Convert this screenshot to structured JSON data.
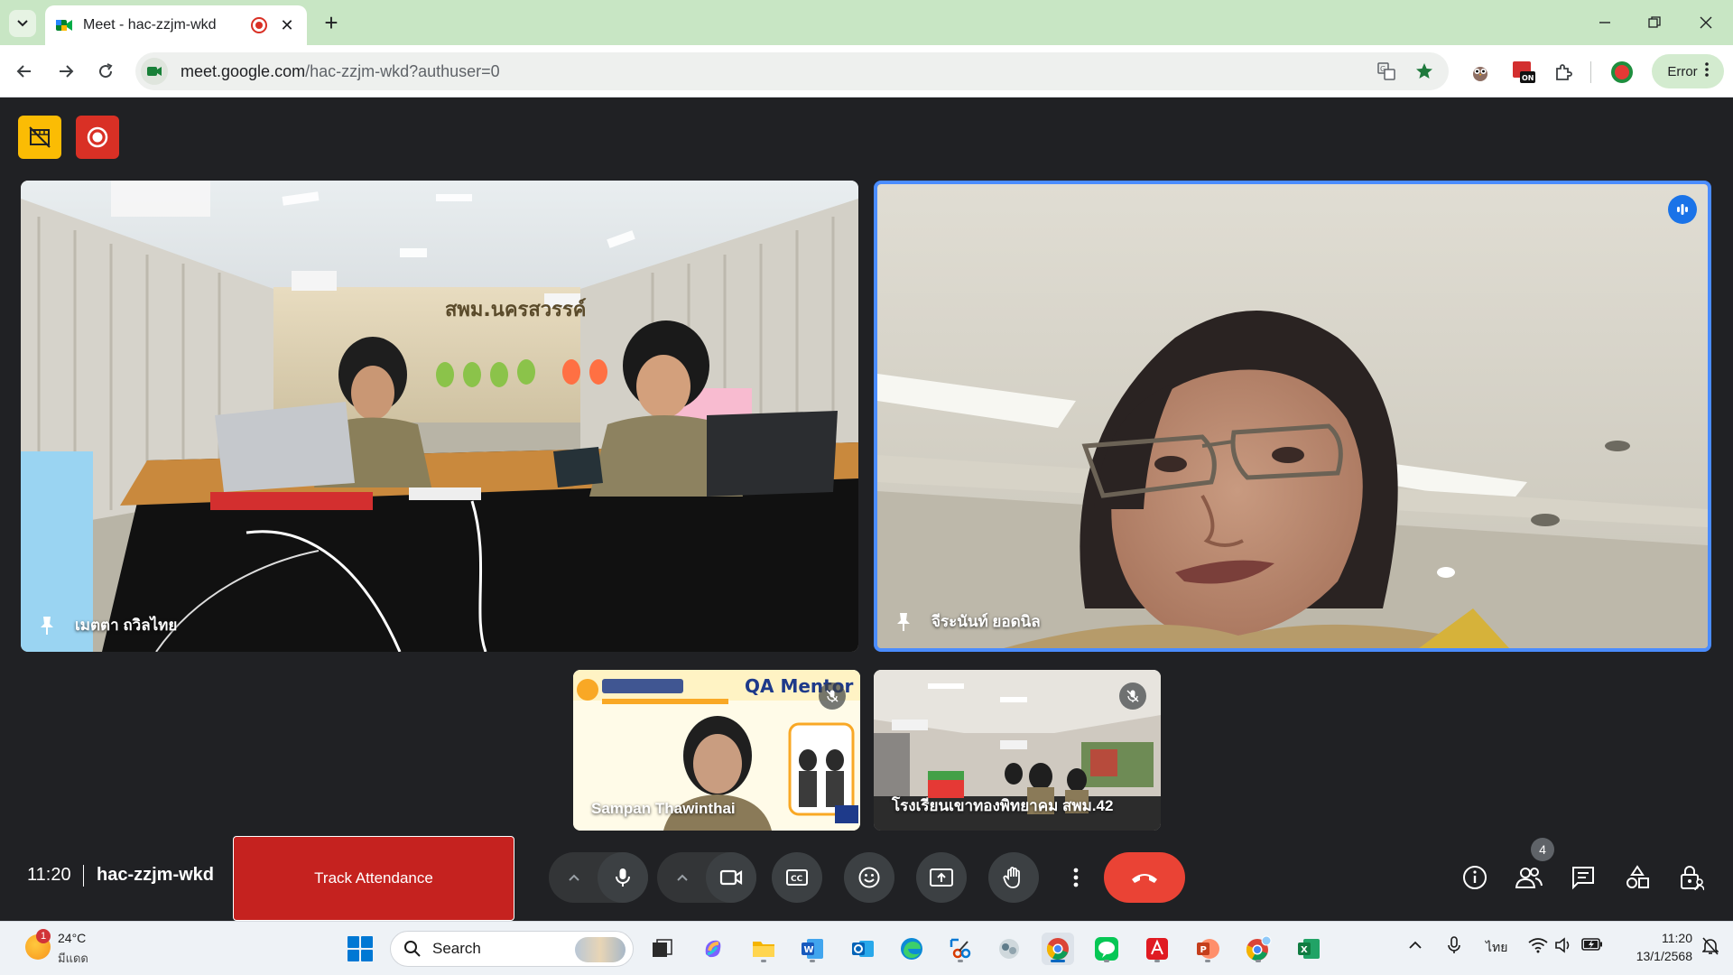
{
  "browser": {
    "tab_title": "Meet - hac-zzjm-wkd",
    "new_tab_symbol": "+",
    "url_host": "meet.google.com",
    "url_path": "/hac-zzjm-wkd?authuser=0",
    "profile_status": "Error"
  },
  "meet": {
    "participants": [
      {
        "name": "เมตตา ถวิลไทย"
      },
      {
        "name": "จีระนันท์ ยอดนิล"
      },
      {
        "name": "Sampan Thawinthai"
      },
      {
        "name": "โรงเรียนเขาทองพิทยาคม สพม.42"
      }
    ],
    "time": "11:20",
    "meeting_code": "hac-zzjm-wkd",
    "track_attendance_label": "Track Attendance",
    "people_count": "4"
  },
  "taskbar": {
    "weather_temp": "24°C",
    "weather_condition": "มีแดด",
    "weather_badge": "1",
    "search_label": "Search",
    "input_language": "ไทย",
    "clock_time": "11:20",
    "clock_date": "13/1/2568"
  },
  "colors": {
    "meet_background": "#202124",
    "end_call": "#ea4335",
    "track_attendance": "#c5221f",
    "active_speaker_border": "#4a8cff",
    "chrome_frame": "#c8e6c4"
  }
}
